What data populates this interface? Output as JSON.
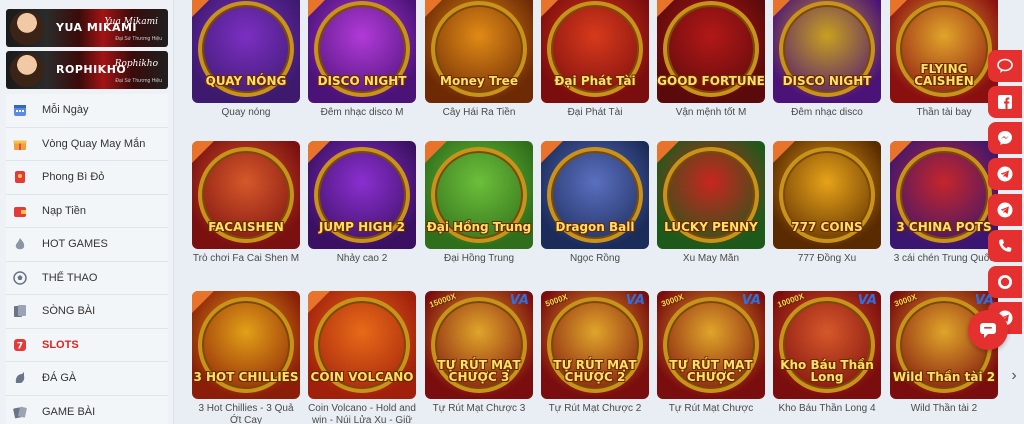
{
  "sidebar": {
    "banners": [
      {
        "name": "YUA MIKAMI",
        "sig": "Yua Mikami",
        "sub": "Đại Sứ Thương Hiệu"
      },
      {
        "name": "ROPHIKHO",
        "sig": "Rophikho",
        "sub": "Đại Sứ Thương Hiệu"
      }
    ],
    "items": [
      {
        "label": "Mỗi Ngày",
        "icon": "calendar-icon"
      },
      {
        "label": "Vòng Quay May Mắn",
        "icon": "gift-icon"
      },
      {
        "label": "Phong Bì Đỏ",
        "icon": "red-envelope-icon"
      },
      {
        "label": "Nạp Tiền",
        "icon": "wallet-icon"
      },
      {
        "label": "HOT GAMES",
        "icon": "flame-icon"
      },
      {
        "label": "THỂ THAO",
        "icon": "soccer-ball-icon"
      },
      {
        "label": "SÒNG BÀI",
        "icon": "cards-icon"
      },
      {
        "label": "SLOTS",
        "icon": "slot-777-icon",
        "active": true
      },
      {
        "label": "ĐÁ GÀ",
        "icon": "rooster-icon"
      },
      {
        "label": "GAME BÀI",
        "icon": "card-game-icon"
      }
    ]
  },
  "games": [
    {
      "title": "Quay nóng",
      "logo": "QUAY NÓNG",
      "bg": "#3d1a6e",
      "disc": "#7b2fc2",
      "hot": true
    },
    {
      "title": "Đêm nhạc disco M",
      "logo": "DISCO NIGHT",
      "bg": "#4b1278",
      "disc": "#b13ad8",
      "hot": true
    },
    {
      "title": "Cây Hái Ra Tiền",
      "logo": "Money Tree",
      "bg": "#6e2a05",
      "disc": "#e08a16",
      "hot": true
    },
    {
      "title": "Đại Phát Tài",
      "logo": "Đại Phát Tài",
      "bg": "#7a0d0d",
      "disc": "#d73a1c",
      "hot": true
    },
    {
      "title": "Vận mệnh tốt M",
      "logo": "GOOD FORTUNE",
      "bg": "#5a0a0a",
      "disc": "#b31818",
      "hot": true
    },
    {
      "title": "Đêm nhạc disco",
      "logo": "DISCO NIGHT",
      "bg": "#4b1278",
      "disc": "#c7a020",
      "hot": true
    },
    {
      "title": "Thần tài bay",
      "logo": "FLYING CAISHEN",
      "bg": "#8a1010",
      "disc": "#e0a52a",
      "hot": true
    },
    {
      "title": "Trò chơi Fa Cai Shen M",
      "logo": "FACAISHEN",
      "bg": "#7a1010",
      "disc": "#d6582a",
      "hot": true
    },
    {
      "title": "Nhảy cao 2",
      "logo": "JUMP HIGH 2",
      "bg": "#3b1062",
      "disc": "#8a2fd0",
      "hot": true
    },
    {
      "title": "Đại Hồng Trung",
      "logo": "Đại Hồng Trung",
      "bg": "#2f6e1a",
      "disc": "#6cbf3b",
      "hot": true
    },
    {
      "title": "Ngọc Rồng",
      "logo": "Dragon Ball",
      "bg": "#1c2c5a",
      "disc": "#5a6fc0",
      "hot": true
    },
    {
      "title": "Xu May Mắn",
      "logo": "LUCKY PENNY",
      "bg": "#1d5a1a",
      "disc": "#c8261f",
      "hot": true
    },
    {
      "title": "777 Đồng Xu",
      "logo": "777 COINS",
      "bg": "#5a2a00",
      "disc": "#e6a319",
      "hot": true
    },
    {
      "title": "3 cái chén Trung Quốc",
      "logo": "3 CHINA POTS",
      "bg": "#3a1670",
      "disc": "#c4262a",
      "hot": true
    },
    {
      "title": "3 Hot Chillies - 3 Quả Ớt Cay",
      "logo": "3 HOT CHILLIES",
      "bg": "#8a1e08",
      "disc": "#e2a017",
      "hot": true
    },
    {
      "title": "Coin Volcano - Hold and win - Núi Lửa Xu - Giữ và thắng",
      "logo": "COIN VOLCANO",
      "bg": "#a0200c",
      "disc": "#e86a18",
      "hot": true
    },
    {
      "title": "Tự Rút Mạt Chược 3",
      "logo": "TỰ RÚT MẠT CHƯỢC 3",
      "bg": "#7a0d0d",
      "disc": "#e0a52a",
      "va": "VA",
      "mult": "15000X"
    },
    {
      "title": "Tự Rút Mạt Chược 2",
      "logo": "TỰ RÚT MẠT CHƯỢC 2",
      "bg": "#7a0d0d",
      "disc": "#e0a52a",
      "va": "VA",
      "mult": "5000X"
    },
    {
      "title": "Tự Rút Mạt Chược",
      "logo": "TỰ RÚT MẠT CHƯỢC",
      "bg": "#7a0d0d",
      "disc": "#e0a52a",
      "va": "VA",
      "mult": "3000X"
    },
    {
      "title": "Kho Báu Thần Long 4",
      "logo": "Kho Báu Thần Long",
      "bg": "#7a0d0d",
      "disc": "#d6582a",
      "va": "VA",
      "mult": "10000X"
    },
    {
      "title": "Wild Thần tài 2",
      "logo": "Wild Thần tài 2",
      "bg": "#7a0d0d",
      "disc": "#e0a52a",
      "va": "VA",
      "mult": "3000X"
    }
  ],
  "float_buttons": [
    "chat-bubble-icon",
    "facebook-icon",
    "messenger-icon",
    "telegram-icon",
    "telegram-icon",
    "phone-icon",
    "support-icon",
    "telegram-icon"
  ]
}
